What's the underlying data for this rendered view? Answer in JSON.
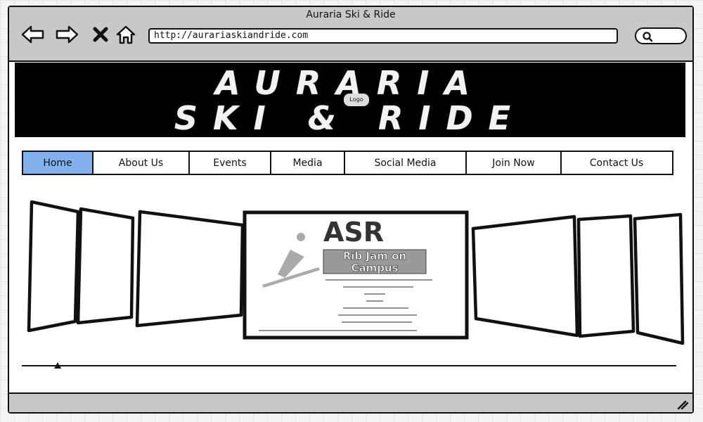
{
  "window": {
    "title": "Auraria Ski & Ride"
  },
  "browser": {
    "url": "http://aurariaskiandride.com",
    "icons": [
      "back-arrow-icon",
      "forward-arrow-icon",
      "close-x-icon",
      "home-icon",
      "search-icon"
    ]
  },
  "banner": {
    "line1": "AURARIA",
    "line2": "SKI & RIDE",
    "logo_label": "Logo"
  },
  "nav": {
    "items": [
      "Home",
      "About Us",
      "Events",
      "Media",
      "Social Media",
      "Join Now",
      "Contact Us"
    ],
    "active": "Home",
    "active_color": "#82b2ed"
  },
  "featured_slide": {
    "brand": "ASR",
    "headline_line1": "Rib Jam on",
    "headline_line2": "Campus"
  },
  "colors": {
    "chrome": "#c8c8c8",
    "accent": "#82b2ed",
    "banner_bg": "#000000"
  }
}
